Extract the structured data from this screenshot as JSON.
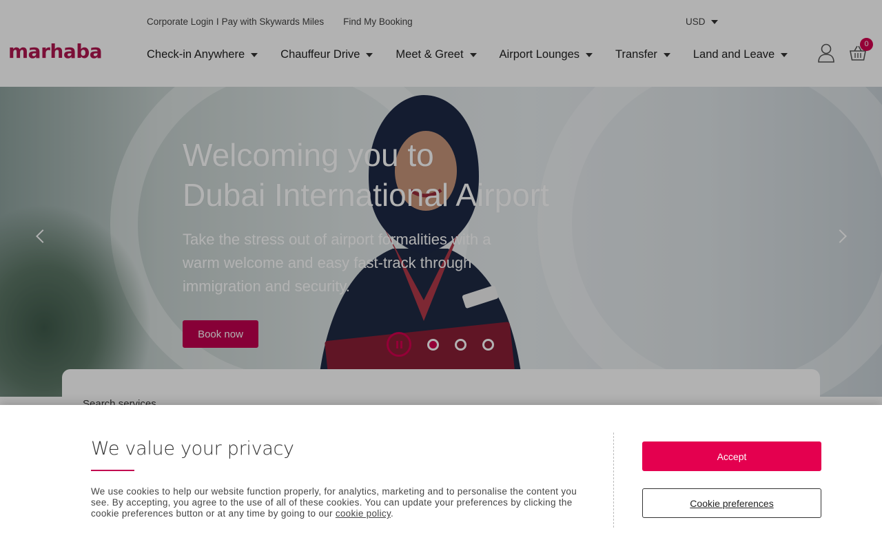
{
  "topbar": {
    "corporate_login": "Corporate Login",
    "separator": "I",
    "pay_skywards": "Pay with Skywards Miles",
    "find_booking": "Find My Booking",
    "currency": "USD"
  },
  "logo": {
    "text": "marhaba"
  },
  "nav": {
    "items": [
      {
        "label": "Check-in Anywhere"
      },
      {
        "label": "Chauffeur Drive"
      },
      {
        "label": "Meet & Greet"
      },
      {
        "label": "Airport Lounges"
      },
      {
        "label": "Transfer"
      },
      {
        "label": "Land and Leave"
      }
    ]
  },
  "cart": {
    "count": "0"
  },
  "hero": {
    "title_line1": "Welcoming you to",
    "title_line2": "Dubai International Airport",
    "subtitle": "Take the stress out of airport formalities with a warm welcome and easy fast-track through immigration and security.",
    "book_label": "Book now",
    "slide_count": 3,
    "active_slide": 1
  },
  "search": {
    "label": "Search services"
  },
  "cookie": {
    "title": "We value your privacy",
    "text": "We use cookies to help our website function properly, for analytics, marketing and to personalise the content you see. By accepting, you agree to the use of all of these cookies. You can update your preferences by clicking the cookie preferences button or at any time by going to our ",
    "link": "cookie policy",
    "period": ".",
    "accept_label": "Accept",
    "prefs_label": "Cookie preferences"
  },
  "colors": {
    "brand": "#c2004f",
    "accent": "#e4004f"
  },
  "icons": [
    "chevron-down-icon",
    "user-icon",
    "cart-icon",
    "arrow-left-icon",
    "arrow-right-icon",
    "pause-icon"
  ]
}
